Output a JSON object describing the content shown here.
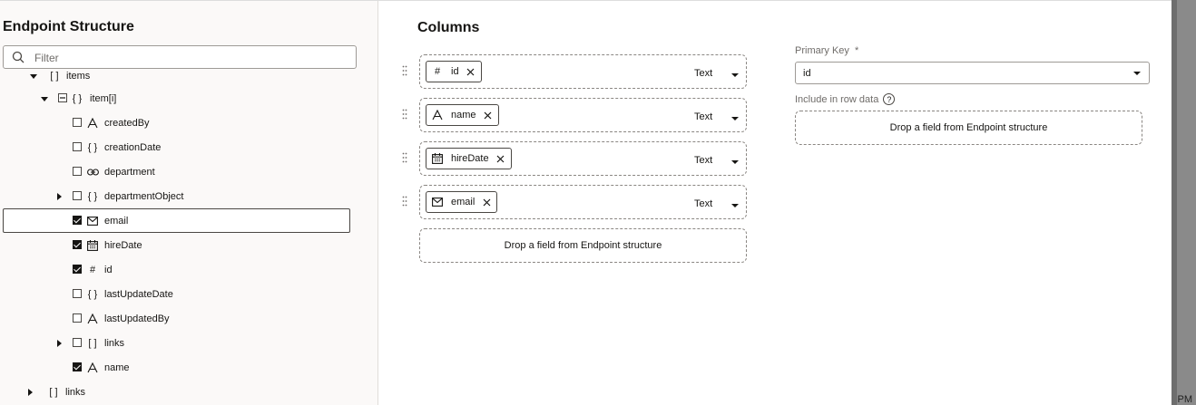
{
  "endpoint_structure": {
    "title": "Endpoint Structure",
    "filter_placeholder": "Filter",
    "tree": [
      {
        "label": "items",
        "type_icon": "array-icon",
        "checked": null,
        "expand": "expanded",
        "partial": true
      },
      {
        "label": "item[i]",
        "type_icon": "object-icon",
        "checked": "partial",
        "expand": "expanded"
      },
      {
        "label": "createdBy",
        "type_icon": "text-icon",
        "checked": false
      },
      {
        "label": "creationDate",
        "type_icon": "object-icon",
        "checked": false
      },
      {
        "label": "department",
        "type_icon": "link-icon",
        "checked": false
      },
      {
        "label": "departmentObject",
        "type_icon": "object-icon",
        "checked": false,
        "expand": "collapsed"
      },
      {
        "label": "email",
        "type_icon": "mail-icon",
        "checked": true,
        "selected": true
      },
      {
        "label": "hireDate",
        "type_icon": "calendar-icon",
        "checked": true
      },
      {
        "label": "id",
        "type_icon": "number-icon",
        "checked": true
      },
      {
        "label": "lastUpdateDate",
        "type_icon": "object-icon",
        "checked": false
      },
      {
        "label": "lastUpdatedBy",
        "type_icon": "text-icon",
        "checked": false
      },
      {
        "label": "links",
        "type_icon": "array-icon",
        "checked": false,
        "expand": "collapsed"
      },
      {
        "label": "name",
        "type_icon": "text-icon",
        "checked": true
      },
      {
        "label": "links",
        "type_icon": "array-icon",
        "checked": null,
        "expand": "collapsed"
      }
    ]
  },
  "columns": {
    "title": "Columns",
    "items": [
      {
        "field": "id",
        "icon": "number-icon",
        "type": "Text"
      },
      {
        "field": "name",
        "icon": "text-icon",
        "type": "Text"
      },
      {
        "field": "hireDate",
        "icon": "calendar-icon",
        "type": "Text"
      },
      {
        "field": "email",
        "icon": "mail-icon",
        "type": "Text"
      }
    ],
    "drop_text": "Drop a field from Endpoint structure"
  },
  "primary_key": {
    "label": "Primary Key",
    "required_mark": "*",
    "value": "id"
  },
  "row_data": {
    "label": "Include in row data",
    "help_glyph": "?",
    "drop_text": "Drop a field from Endpoint structure"
  },
  "background": {
    "time_fragment": "PM"
  },
  "colors": {
    "panel_bg": "#fbf9f8",
    "text": "#161513",
    "muted": "#6f6c69",
    "border": "#9e9a96"
  }
}
